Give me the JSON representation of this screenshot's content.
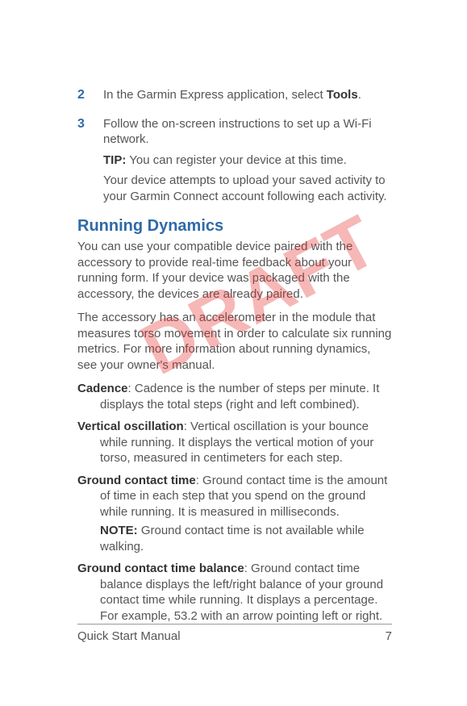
{
  "steps": [
    {
      "num": "2",
      "lines": [
        {
          "pre": "In the Garmin Express application, select ",
          "bold": "Tools",
          "post": "."
        }
      ]
    },
    {
      "num": "3",
      "lines": [
        {
          "text": "Follow the on-screen instructions to set up a Wi-Fi network."
        },
        {
          "tipLabel": "TIP:",
          "tipText": " You can register your device at this time."
        },
        {
          "text": "Your device attempts to upload your saved activity to your Garmin Connect account following each activity."
        }
      ]
    }
  ],
  "sectionTitle": "Running Dynamics",
  "paragraphs": [
    "You can use your compatible device paired with the accessory to provide real-time feedback about your running form. If your device was packaged with the accessory, the devices are already paired.",
    "The accessory has an accelerometer in the module that measures torso movement in order to calculate six running metrics. For more information about running dynamics, see your owner's manual."
  ],
  "defs": [
    {
      "term": "Cadence",
      "body": ": Cadence is the number of steps per minute. It displays the total steps (right and left combined)."
    },
    {
      "term": "Vertical oscillation",
      "body": ": Vertical oscillation is your bounce while running. It displays the vertical motion of your torso, measured in centimeters for each step."
    },
    {
      "term": "Ground contact time",
      "body": ": Ground contact time is the amount of time in each step that you spend on the ground while running. It is measured in milliseconds.",
      "noteLabel": "NOTE:",
      "noteText": " Ground contact time is not available while walking."
    },
    {
      "term": "Ground contact time balance",
      "body": ": Ground contact time balance displays the left/right balance of your ground contact time while running. It displays a percentage. For example, 53.2 with an arrow pointing left or right."
    }
  ],
  "watermark": "DRAFT",
  "footer": {
    "left": "Quick Start Manual",
    "right": "7"
  }
}
